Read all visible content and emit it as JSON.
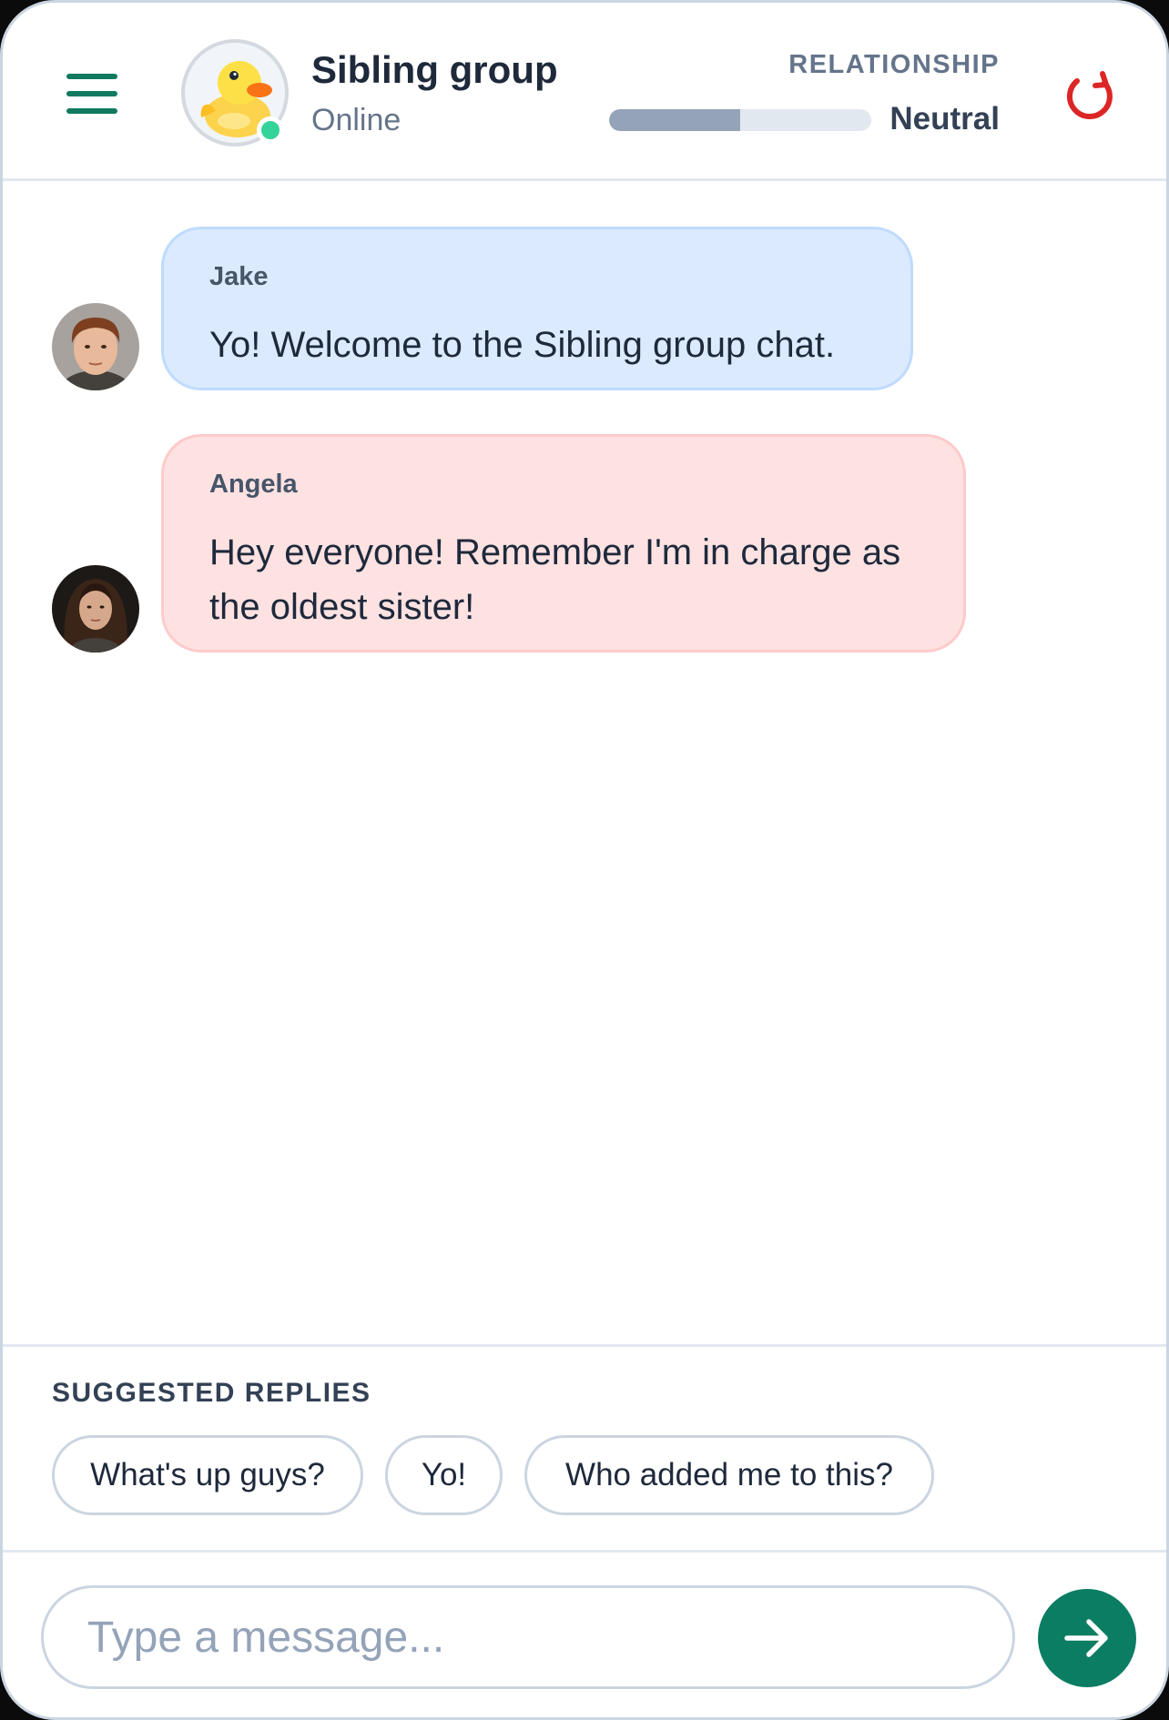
{
  "header": {
    "title": "Sibling group",
    "status": "Online",
    "relationship_label": "RELATIONSHIP",
    "relationship_value": "Neutral",
    "relationship_level": 0.5
  },
  "messages": [
    {
      "sender": "Jake",
      "text": "Yo! Welcome to the Sibling group chat.",
      "color": "#dbeafe"
    },
    {
      "sender": "Angela",
      "text": "Hey everyone! Remember I'm in charge as the oldest sister!",
      "color": "#fee2e2"
    }
  ],
  "suggestions": {
    "title": "SUGGESTED REPLIES",
    "items": [
      "What's up guys?",
      "Yo!",
      "Who added me to this?"
    ]
  },
  "composer": {
    "placeholder": "Type a message...",
    "value": ""
  },
  "icons": {
    "menu": "hamburger-menu-icon",
    "reset": "refresh-icon",
    "send": "arrow-right-icon",
    "group_avatar": "duck-emoji"
  },
  "colors": {
    "accent": "#0b7d62",
    "online": "#34d399",
    "reset": "#dc2626"
  }
}
